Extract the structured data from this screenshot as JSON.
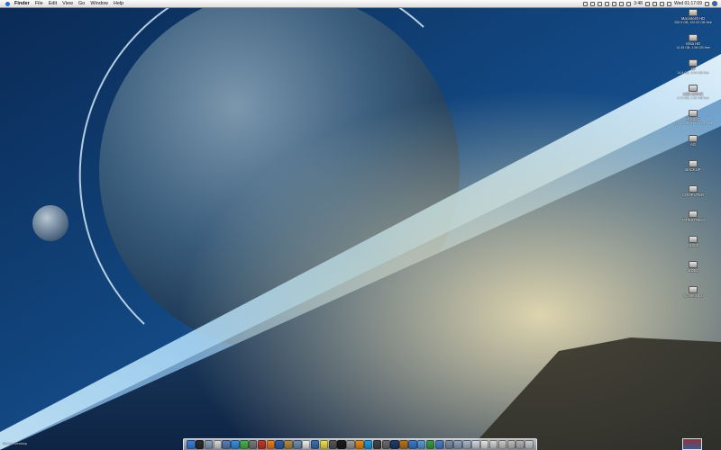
{
  "menubar": {
    "app_name": "Finder",
    "menus": [
      "File",
      "Edit",
      "View",
      "Go",
      "Window",
      "Help"
    ],
    "clock": "Wed 01:17:09",
    "battery_time": "3:48"
  },
  "desktop": {
    "icons": [
      {
        "label": "Macintosh HD",
        "sub": "250.9 GB, 192.53 GB free"
      },
      {
        "label": "Vista HD",
        "sub": "14.45 GB, 1.98 GB free"
      },
      {
        "label": "XP",
        "sub": "14.9 GB, 9.44 GB free"
      },
      {
        "label": "USB DRIVE",
        "sub": "3.73 GB, 1.02 GB free"
      },
      {
        "label": "PUBLIC",
        "sub": "372.52 GB, 275.74 GB free"
      },
      {
        "label": "AG",
        "sub": ""
      },
      {
        "label": "BACKUP",
        "sub": ""
      },
      {
        "label": "COMPUTER",
        "sub": ""
      },
      {
        "label": "TAPESTRIES",
        "sub": ""
      },
      {
        "label": "MUSIC",
        "sub": ""
      },
      {
        "label": "VIDEO",
        "sub": ""
      },
      {
        "label": "Screenshot",
        "sub": ""
      }
    ],
    "corner_text": "Bones Desktop"
  },
  "dock": {
    "items": [
      {
        "name": "finder-dock-icon",
        "color": "#3d7fd6"
      },
      {
        "name": "dashboard-dock-icon",
        "color": "#2d2d2d"
      },
      {
        "name": "mail-dock-icon",
        "color": "#8aa0b8"
      },
      {
        "name": "ical-dock-icon",
        "color": "#d9d9d9"
      },
      {
        "name": "itunes-dock-icon",
        "color": "#5a7db5"
      },
      {
        "name": "safari-dock-icon",
        "color": "#3b8fd8"
      },
      {
        "name": "ichat-dock-icon",
        "color": "#4caf50"
      },
      {
        "name": "system-prefs-dock-icon",
        "color": "#7a7a7a"
      },
      {
        "name": "photobooth-dock-icon",
        "color": "#c0392b"
      },
      {
        "name": "firefox-dock-icon",
        "color": "#e67e22"
      },
      {
        "name": "quicktime-dock-icon",
        "color": "#2f5fa8"
      },
      {
        "name": "address-book-dock-icon",
        "color": "#b08a4a"
      },
      {
        "name": "preview-dock-icon",
        "color": "#6e8fb3"
      },
      {
        "name": "textedit-dock-icon",
        "color": "#eeeeee"
      },
      {
        "name": "iphoto-dock-icon",
        "color": "#3a6fb0"
      },
      {
        "name": "stickies-dock-icon",
        "color": "#f1e04a"
      },
      {
        "name": "calculator-dock-icon",
        "color": "#555555"
      },
      {
        "name": "terminal-dock-icon",
        "color": "#1b1b1b"
      },
      {
        "name": "utility-dock-icon",
        "color": "#9a9a9a"
      },
      {
        "name": "vlc-dock-icon",
        "color": "#e08a1e"
      },
      {
        "name": "skype-dock-icon",
        "color": "#1e9be0"
      },
      {
        "name": "chess-dock-icon",
        "color": "#444444"
      },
      {
        "name": "monitor-dock-icon",
        "color": "#6b6b6b"
      },
      {
        "name": "photoshop-dock-icon",
        "color": "#1e3a6b"
      },
      {
        "name": "illustrator-dock-icon",
        "color": "#b6741f"
      },
      {
        "name": "pages-dock-icon",
        "color": "#3c78c8"
      },
      {
        "name": "keynote-dock-icon",
        "color": "#5b9ad6"
      },
      {
        "name": "numbers-dock-icon",
        "color": "#3c9a48"
      },
      {
        "name": "app-store-dock-icon",
        "color": "#4a80c6"
      },
      {
        "name": "sep",
        "color": ""
      },
      {
        "name": "downloads-stack-icon",
        "color": "#7a8fa6"
      },
      {
        "name": "documents-stack-icon",
        "color": "#8fa4bd"
      },
      {
        "name": "applications-stack-icon",
        "color": "#a7b6c8"
      },
      {
        "name": "window-1-icon",
        "color": "#cfd6df"
      },
      {
        "name": "window-2-icon",
        "color": "#e4e4e4"
      },
      {
        "name": "window-3-icon",
        "color": "#d6d6d6"
      },
      {
        "name": "window-4-icon",
        "color": "#c9c9c9"
      },
      {
        "name": "window-5-icon",
        "color": "#bdbdbd"
      },
      {
        "name": "window-6-icon",
        "color": "#b3b3b3"
      },
      {
        "name": "trash-icon",
        "color": "#c8cbd0"
      }
    ]
  }
}
